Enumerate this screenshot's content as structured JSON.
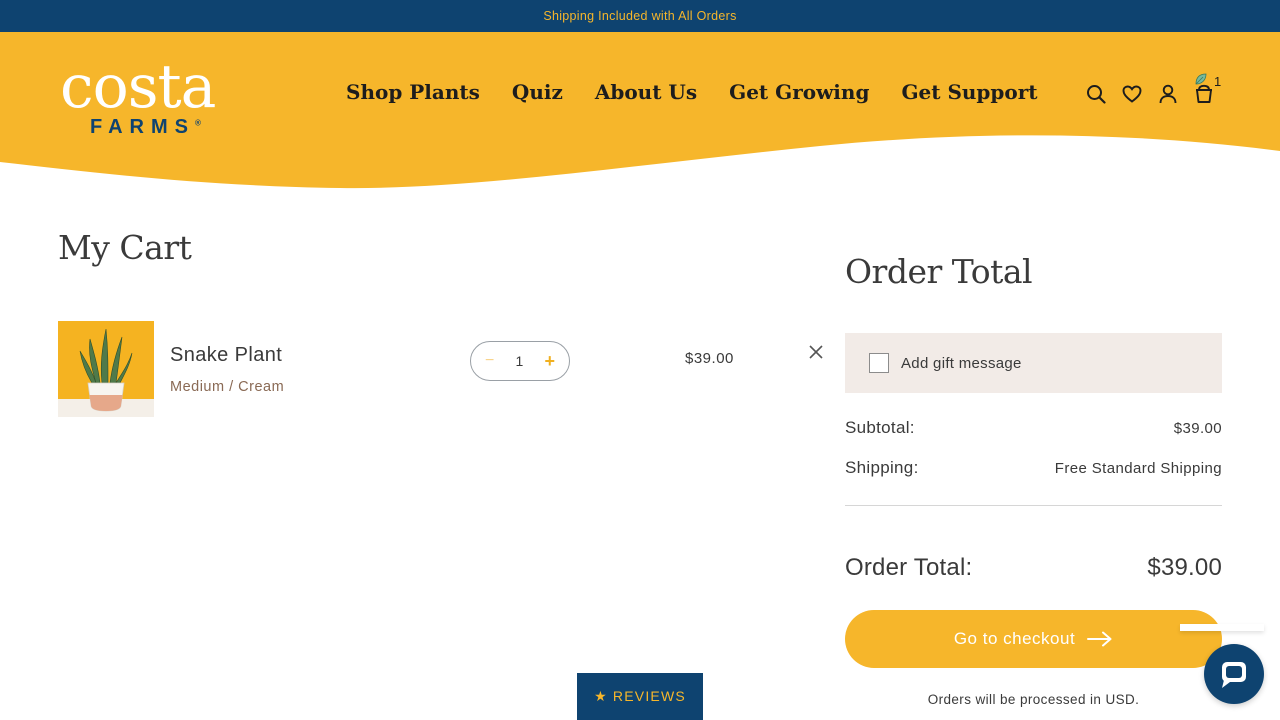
{
  "announcement": "Shipping Included with All Orders",
  "logo": {
    "main": "costa",
    "sub": "FARMS",
    "mark": "®"
  },
  "nav": [
    "Shop Plants",
    "Quiz",
    "About Us",
    "Get Growing",
    "Get Support"
  ],
  "header_icons": [
    "search-icon",
    "heart-icon",
    "user-icon",
    "cart-icon"
  ],
  "cart_count": "1",
  "cart": {
    "title": "My Cart",
    "items": [
      {
        "name": "Snake Plant",
        "variant": "Medium / Cream",
        "quantity": "1",
        "price": "$39.00",
        "minus": "−",
        "plus": "+"
      }
    ]
  },
  "order": {
    "title": "Order Total",
    "gift_label": "Add gift message",
    "subtotal_label": "Subtotal:",
    "subtotal_value": "$39.00",
    "shipping_label": "Shipping:",
    "shipping_value": "Free Standard Shipping",
    "total_label": "Order Total:",
    "total_value": "$39.00",
    "checkout_label": "Go to checkout",
    "currency_note": "Orders will be processed in USD."
  },
  "reviews_label": "★ REVIEWS",
  "colors": {
    "brand_navy": "#0e4370",
    "brand_yellow": "#f6b62b",
    "gift_bg": "#f2ebe7"
  }
}
